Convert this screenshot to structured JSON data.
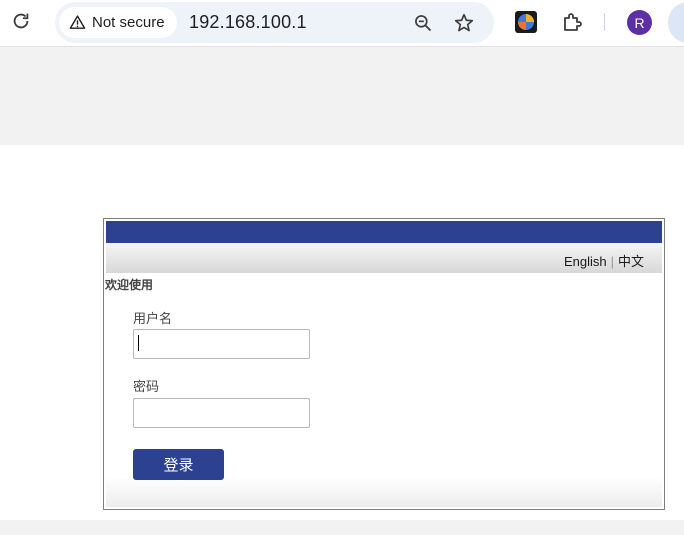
{
  "browser": {
    "security_label": "Not secure",
    "url": "192.168.100.1",
    "avatar_letter": "R",
    "icons": [
      "reload-icon",
      "warning-icon",
      "zoom-icon",
      "star-icon",
      "extension-icon",
      "puzzle-icon"
    ]
  },
  "header": {
    "lang_english": "English",
    "lang_separator": "|",
    "lang_chinese": "中文"
  },
  "login": {
    "welcome": "欢迎使用",
    "username_label": "用户名",
    "username_value": "",
    "password_label": "密码",
    "password_value": "",
    "submit_label": "登录"
  },
  "colors": {
    "brand_blue": "#2c4290",
    "band_gray": "#f2f2f2"
  }
}
